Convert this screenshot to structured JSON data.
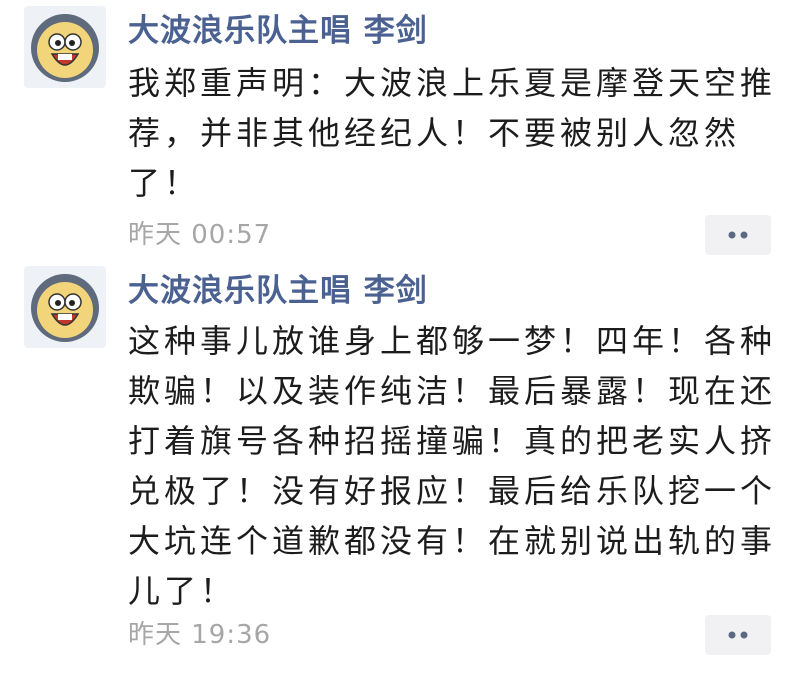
{
  "comments": [
    {
      "author": "大波浪乐队主唱 李剑",
      "text": "我郑重声明：大波浪上乐夏是摩登天空推荐，并非其他经纪人！不要被别人忽然了！",
      "time": "昨天 00:57",
      "avatar_icon": "cartoon-face-avatar",
      "more_icon": "more-dots-icon"
    },
    {
      "author": "大波浪乐队主唱 李剑",
      "text": "这种事儿放谁身上都够一梦！四年！各种欺骗！以及装作纯洁！最后暴露！现在还打着旗号各种招摇撞骗！真的把老实人挤兑极了！没有好报应！最后给乐队挖一个大坑连个道歉都没有！在就别说出轨的事儿了！",
      "time": "昨天 19:36",
      "avatar_icon": "cartoon-face-avatar",
      "more_icon": "more-dots-icon"
    }
  ],
  "colors": {
    "author_name": "#4a6192",
    "body_text": "#1c1c1c",
    "timestamp": "#a6a6a6",
    "more_button_bg": "#f1f1f3",
    "avatar_bg": "#eef2f6"
  }
}
